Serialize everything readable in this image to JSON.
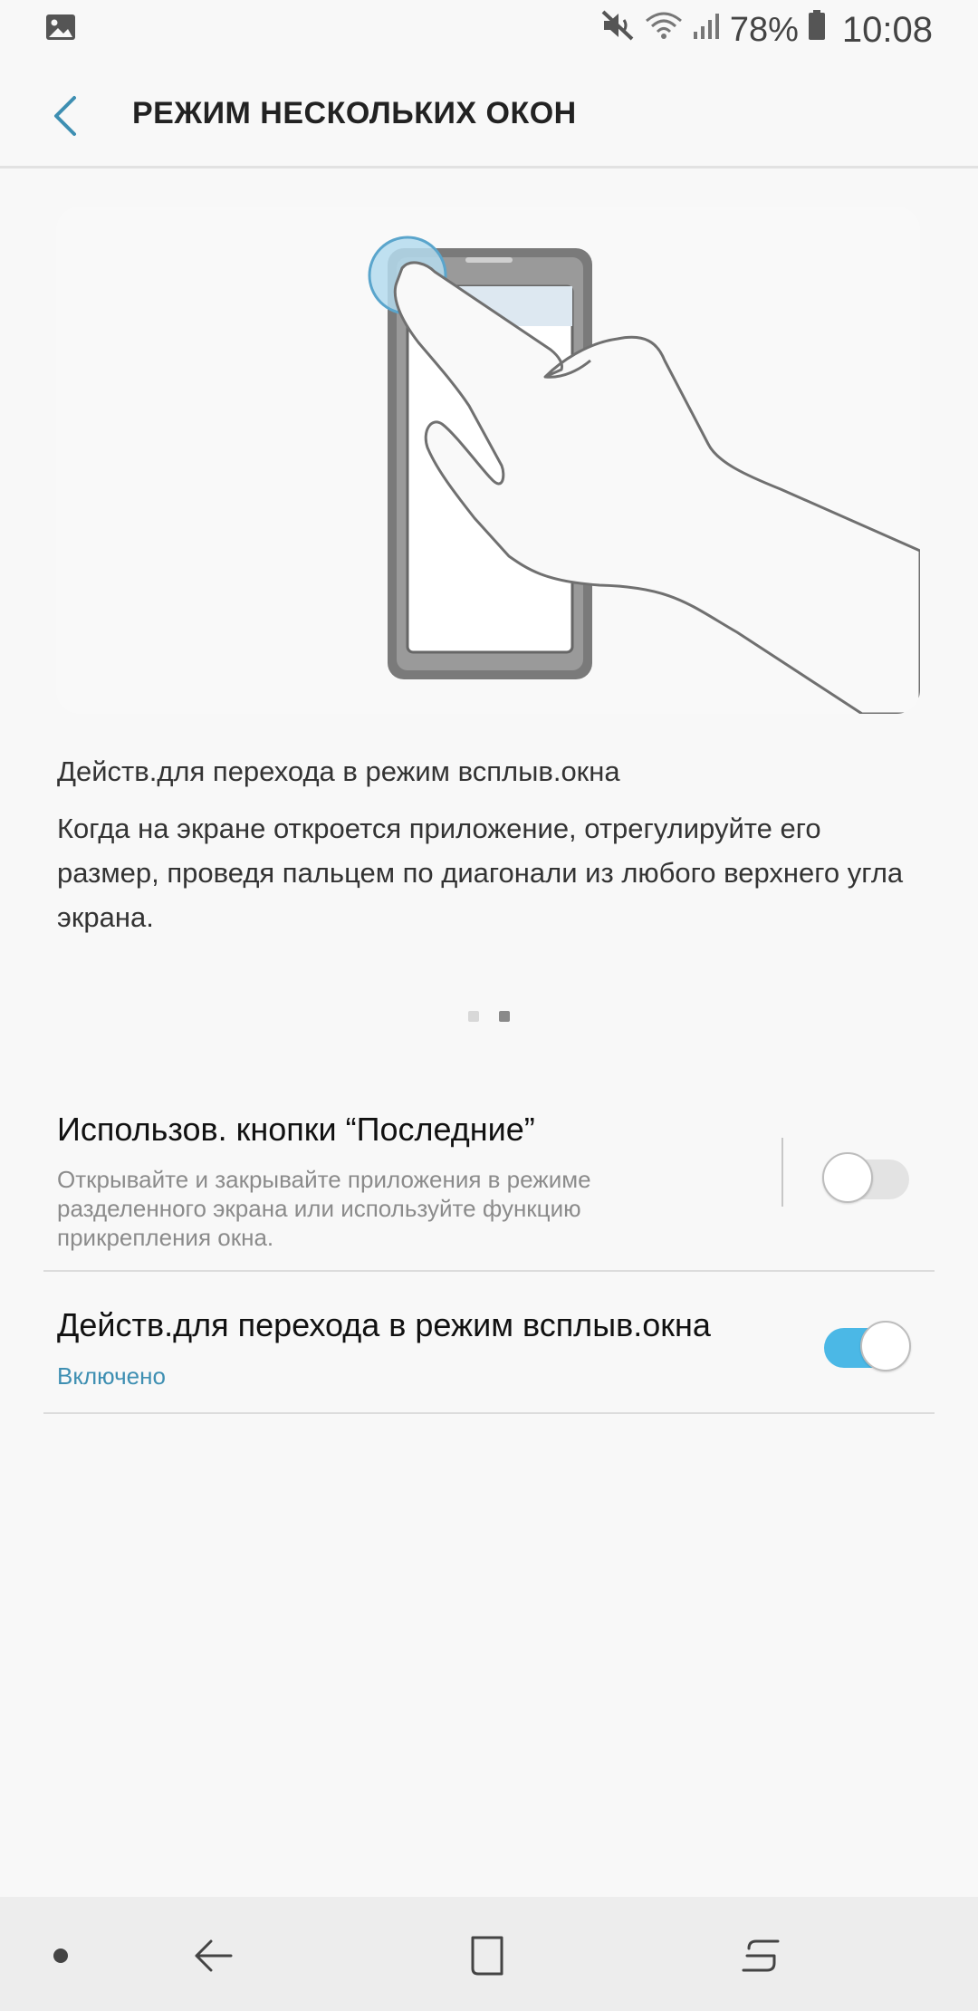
{
  "status_bar": {
    "left_icon": "image-notification-icon",
    "icons": [
      "mute-icon",
      "wifi-icon",
      "signal-icon",
      "battery-icon"
    ],
    "battery": "78%",
    "time": "10:08"
  },
  "header": {
    "back_icon": "back-arrow-icon",
    "title": "РЕЖИМ НЕСКОЛЬКИХ ОКОН"
  },
  "tutorial": {
    "illustration": "hand-swiping-diagonally-on-phone",
    "title": "Действ.для перехода в режим всплыв.окна",
    "description": "Когда на экране откроется приложение, отрегулируйте его размер, проведя пальцем по диагонали из любого верхнего угла экрана.",
    "page_count": 2,
    "current_page": 2
  },
  "settings": [
    {
      "title": "Использов. кнопки “Последние”",
      "summary": "Открывайте и закрывайте приложения в режиме разделенного экрана или используйте функцию прикрепления окна.",
      "enabled": false
    },
    {
      "title": "Действ.для перехода в режим всплыв.окна",
      "status": "Включено",
      "enabled": true
    }
  ],
  "nav_bar": {
    "items": [
      "dot-icon",
      "back-icon",
      "home-icon",
      "recents-icon"
    ]
  },
  "colors": {
    "accent": "#3e8fb2",
    "switch_on": "#4bb8e6",
    "background": "#f8f8f8"
  }
}
